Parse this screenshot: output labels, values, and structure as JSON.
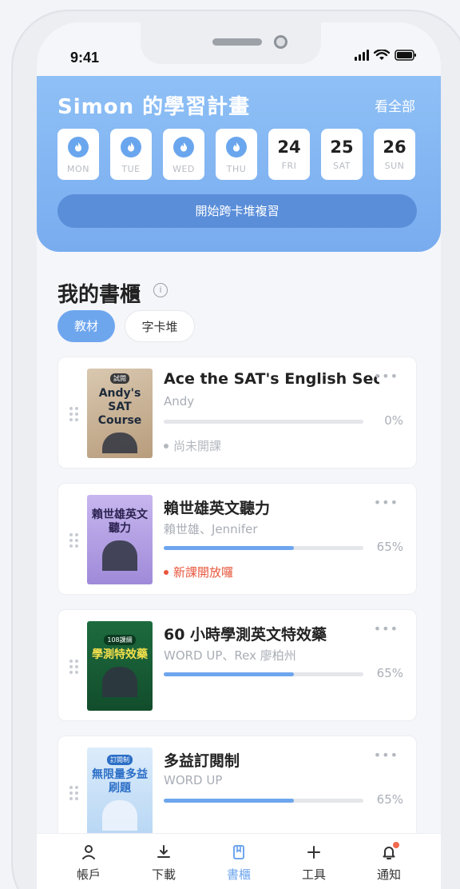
{
  "status": {
    "time": "9:41"
  },
  "plan": {
    "title": "Simon 的學習計畫",
    "see_all": "看全部",
    "days": [
      {
        "label": "MON",
        "done": true
      },
      {
        "label": "TUE",
        "done": true
      },
      {
        "label": "WED",
        "done": true
      },
      {
        "label": "THU",
        "done": true
      },
      {
        "label": "FRI",
        "date": "24",
        "done": false
      },
      {
        "label": "SAT",
        "date": "25",
        "done": false
      },
      {
        "label": "SUN",
        "date": "26",
        "done": false
      }
    ],
    "review_button": "開始跨卡堆複習"
  },
  "shelf": {
    "title": "我的書櫃",
    "tabs": [
      "教材",
      "字卡堆"
    ],
    "books": [
      {
        "title": "Ace the SAT's English Sec...",
        "author": "Andy",
        "progress": 0,
        "progress_label": "0%",
        "status": "尚未開課",
        "status_color": "#b3b8bf",
        "cover_text": "Andy's SAT Course",
        "cover_badge": "試閱"
      },
      {
        "title": "賴世雄英文聽力",
        "author": "賴世雄、Jennifer",
        "progress": 0.65,
        "progress_label": "65%",
        "status": "新課開放囉",
        "status_color": "#e8563c",
        "cover_text": "賴世雄英文聽力"
      },
      {
        "title": "60 小時學測英文特效藥",
        "author": "WORD UP、Rex 廖柏州",
        "progress": 0.65,
        "progress_label": "65%",
        "status": "",
        "cover_text": "學測特效藥",
        "cover_badge": "108課綱"
      },
      {
        "title": "多益訂閱制",
        "author": "WORD UP",
        "progress": 0.65,
        "progress_label": "65%",
        "status": "",
        "cover_text": "無限量多益刷題",
        "cover_badge": "訂閱制"
      }
    ]
  },
  "nav": {
    "items": [
      {
        "label": "帳戶",
        "icon": "user-icon"
      },
      {
        "label": "下載",
        "icon": "download-icon"
      },
      {
        "label": "書櫃",
        "icon": "bookshelf-icon",
        "active": true
      },
      {
        "label": "工具",
        "icon": "plus-icon"
      },
      {
        "label": "通知",
        "icon": "bell-icon",
        "badge": true
      }
    ]
  },
  "colors": {
    "accent": "#6ea6ee",
    "alert": "#e8563c"
  }
}
